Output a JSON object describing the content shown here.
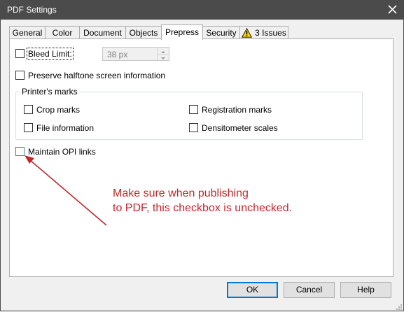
{
  "window": {
    "title": "PDF Settings"
  },
  "tabs": [
    {
      "label": "General"
    },
    {
      "label": "Color"
    },
    {
      "label": "Document"
    },
    {
      "label": "Objects"
    },
    {
      "label": "Prepress",
      "active": true
    },
    {
      "label": "Security"
    },
    {
      "label": "3 Issues",
      "icon": "warning-icon"
    }
  ],
  "prepress": {
    "bleed_limit": {
      "label": "Bleed Limit:",
      "checked": false,
      "value": "38 px"
    },
    "preserve_halftone": {
      "label": "Preserve halftone screen information",
      "checked": false
    },
    "printers_marks": {
      "title": "Printer's marks",
      "crop_marks": {
        "label": "Crop marks",
        "checked": false
      },
      "registration_marks": {
        "label": "Registration marks",
        "checked": false
      },
      "file_information": {
        "label": "File information",
        "checked": false
      },
      "densitometer_scales": {
        "label": "Densitometer scales",
        "checked": false
      }
    },
    "maintain_opi": {
      "label": "Maintain OPI links",
      "checked": false
    }
  },
  "annotation": {
    "text": "Make sure when publishing\nto PDF, this checkbox is unchecked.",
    "color": "#c1272d"
  },
  "buttons": {
    "ok": "OK",
    "cancel": "Cancel",
    "help": "Help"
  },
  "colors": {
    "titlebar": "#4b4b4b",
    "focus_blue": "#0078d7",
    "annotation_red": "#c1272d"
  }
}
